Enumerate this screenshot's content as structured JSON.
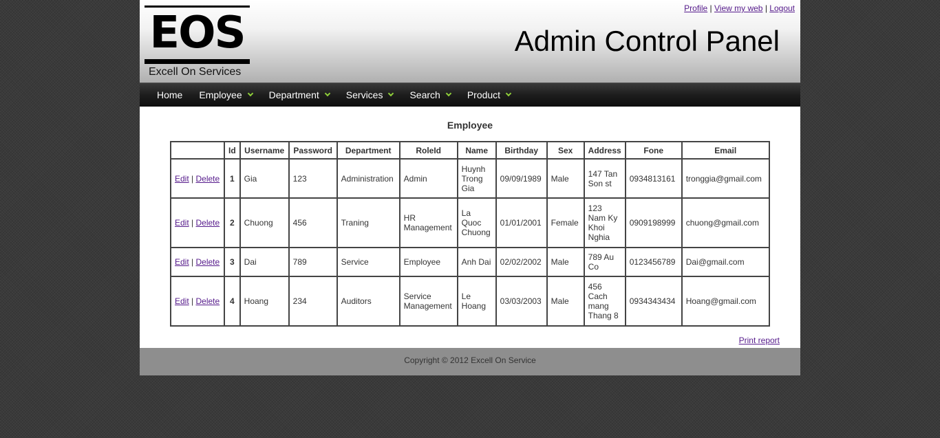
{
  "header": {
    "logo_text": "EOS",
    "logo_subtitle": "Excell On Services",
    "title": "Admin Control Panel",
    "links": [
      "Profile",
      "View my web",
      "Logout"
    ],
    "separator": "|"
  },
  "nav": {
    "items": [
      {
        "label": "Home",
        "dropdown": false
      },
      {
        "label": "Employee",
        "dropdown": true
      },
      {
        "label": "Department",
        "dropdown": true
      },
      {
        "label": "Services",
        "dropdown": true
      },
      {
        "label": "Search",
        "dropdown": true
      },
      {
        "label": "Product",
        "dropdown": true
      }
    ],
    "accent": "#8fcf3a"
  },
  "main": {
    "heading": "Employee",
    "table": {
      "columns": [
        "",
        "Id",
        "Username",
        "Password",
        "Department",
        "RoleId",
        "Name",
        "Birthday",
        "Sex",
        "Address",
        "Fone",
        "Email"
      ],
      "edit_label": "Edit",
      "delete_label": "Delete",
      "rows": [
        {
          "id": "1",
          "username": "Gia",
          "password": "123",
          "department": "Administration",
          "role": "Admin",
          "name": "Huynh Trong Gia",
          "birthday": "09/09/1989",
          "sex": "Male",
          "address": "147 Tan Son st",
          "fone": "0934813161",
          "email": "tronggia@gmail.com"
        },
        {
          "id": "2",
          "username": "Chuong",
          "password": "456",
          "department": "Traning",
          "role": "HR Management",
          "name": "La Quoc Chuong",
          "birthday": "01/01/2001",
          "sex": "Female",
          "address": "123 Nam Ky Khoi Nghia",
          "fone": "0909198999",
          "email": "chuong@gmail.com"
        },
        {
          "id": "3",
          "username": "Dai",
          "password": "789",
          "department": "Service",
          "role": "Employee",
          "name": "Anh Dai",
          "birthday": "02/02/2002",
          "sex": "Male",
          "address": "789 Au Co",
          "fone": "0123456789",
          "email": "Dai@gmail.com"
        },
        {
          "id": "4",
          "username": "Hoang",
          "password": "234",
          "department": "Auditors",
          "role": "Service Management",
          "name": "Le Hoang",
          "birthday": "03/03/2003",
          "sex": "Male",
          "address": "456 Cach mang Thang 8",
          "fone": "0934343434",
          "email": "Hoang@gmail.com"
        }
      ]
    },
    "print_label": "Print report"
  },
  "footer": {
    "copyright": "Copyright © 2012 Excell On Service"
  }
}
